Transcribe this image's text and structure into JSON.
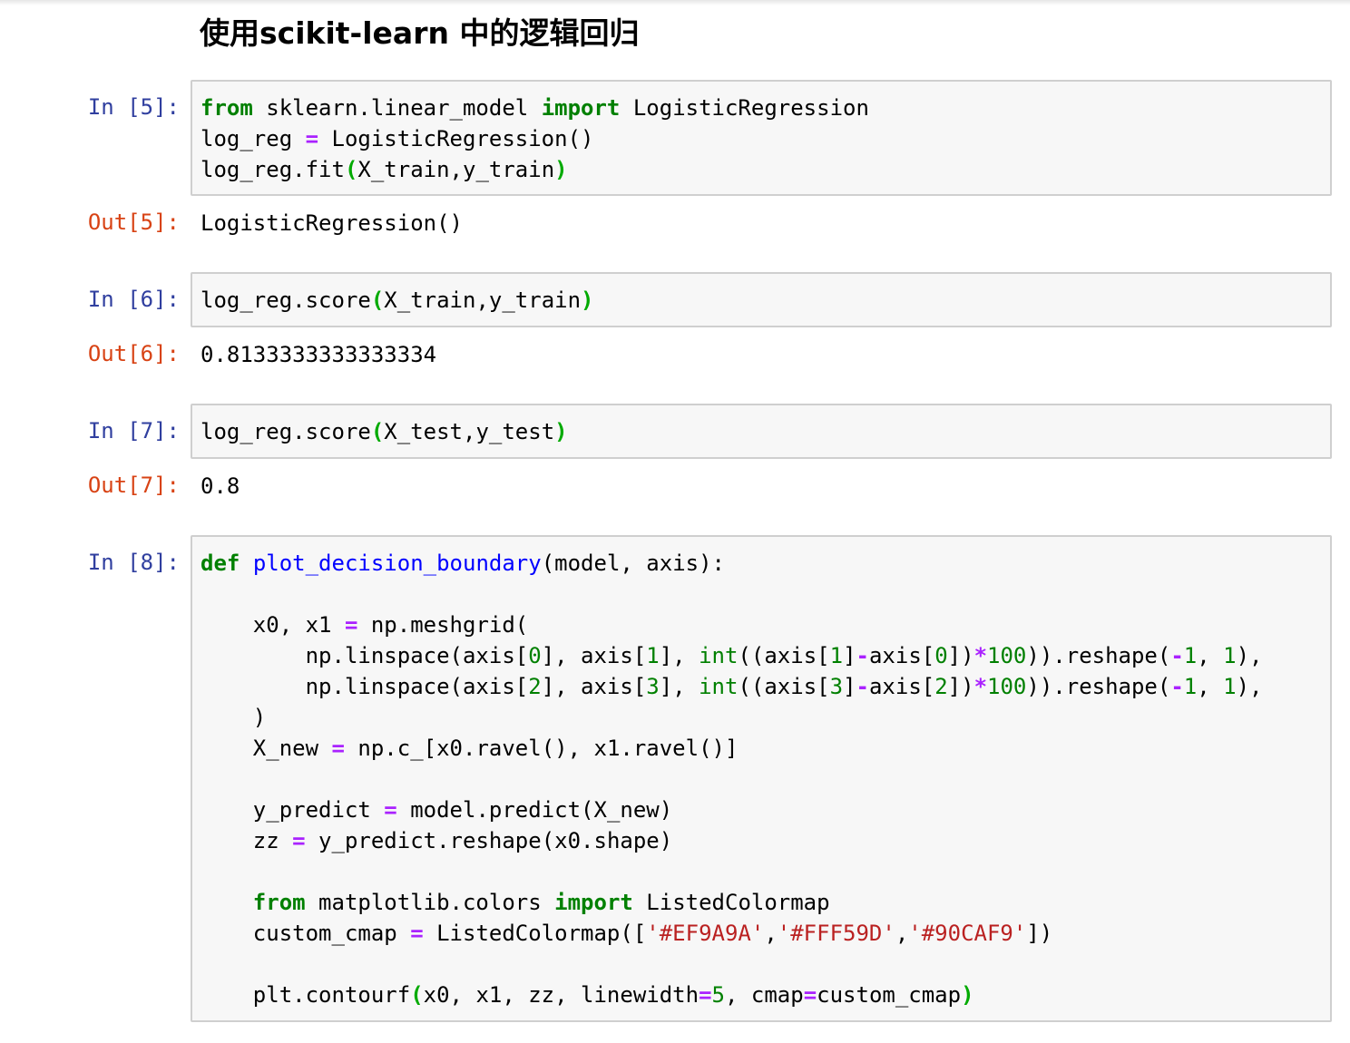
{
  "heading": "使用scikit-learn 中的逻辑回归",
  "cells": [
    {
      "in_prompt": "In [5]:",
      "code_lines": [
        [
          {
            "t": "from",
            "c": "kw"
          },
          {
            "t": " sklearn.linear_model "
          },
          {
            "t": "import",
            "c": "kw"
          },
          {
            "t": " LogisticRegression"
          }
        ],
        [
          {
            "t": "log_reg "
          },
          {
            "t": "=",
            "c": "op"
          },
          {
            "t": " LogisticRegression()"
          }
        ],
        [
          {
            "t": "log_reg.fit"
          },
          {
            "t": "(",
            "c": "paren-hl"
          },
          {
            "t": "X_train,y_train"
          },
          {
            "t": ")",
            "c": "paren-hl"
          }
        ]
      ],
      "out_prompt": "Out[5]:",
      "output": "LogisticRegression()"
    },
    {
      "in_prompt": "In [6]:",
      "code_lines": [
        [
          {
            "t": "log_reg.score"
          },
          {
            "t": "(",
            "c": "paren-hl"
          },
          {
            "t": "X_train,y_train"
          },
          {
            "t": ")",
            "c": "paren-hl"
          }
        ]
      ],
      "out_prompt": "Out[6]:",
      "output": "0.8133333333333334"
    },
    {
      "in_prompt": "In [7]:",
      "code_lines": [
        [
          {
            "t": "log_reg.score"
          },
          {
            "t": "(",
            "c": "paren-hl"
          },
          {
            "t": "X_test,y_test"
          },
          {
            "t": ")",
            "c": "paren-hl"
          }
        ]
      ],
      "out_prompt": "Out[7]:",
      "output": "0.8"
    },
    {
      "in_prompt": "In [8]:",
      "code_lines": [
        [
          {
            "t": "def",
            "c": "kw"
          },
          {
            "t": " "
          },
          {
            "t": "plot_decision_boundary",
            "c": "fn"
          },
          {
            "t": "(model, axis):"
          }
        ],
        [
          {
            "t": ""
          }
        ],
        [
          {
            "t": "    x0, x1 "
          },
          {
            "t": "=",
            "c": "op"
          },
          {
            "t": " np.meshgrid("
          }
        ],
        [
          {
            "t": "        np.linspace(axis["
          },
          {
            "t": "0",
            "c": "num"
          },
          {
            "t": "], axis["
          },
          {
            "t": "1",
            "c": "num"
          },
          {
            "t": "], "
          },
          {
            "t": "int",
            "c": "bi"
          },
          {
            "t": "((axis["
          },
          {
            "t": "1",
            "c": "num"
          },
          {
            "t": "]"
          },
          {
            "t": "-",
            "c": "op"
          },
          {
            "t": "axis["
          },
          {
            "t": "0",
            "c": "num"
          },
          {
            "t": "])"
          },
          {
            "t": "*",
            "c": "op"
          },
          {
            "t": "100",
            "c": "num"
          },
          {
            "t": ")).reshape("
          },
          {
            "t": "-",
            "c": "op"
          },
          {
            "t": "1",
            "c": "num"
          },
          {
            "t": ", "
          },
          {
            "t": "1",
            "c": "num"
          },
          {
            "t": "),"
          }
        ],
        [
          {
            "t": "        np.linspace(axis["
          },
          {
            "t": "2",
            "c": "num"
          },
          {
            "t": "], axis["
          },
          {
            "t": "3",
            "c": "num"
          },
          {
            "t": "], "
          },
          {
            "t": "int",
            "c": "bi"
          },
          {
            "t": "((axis["
          },
          {
            "t": "3",
            "c": "num"
          },
          {
            "t": "]"
          },
          {
            "t": "-",
            "c": "op"
          },
          {
            "t": "axis["
          },
          {
            "t": "2",
            "c": "num"
          },
          {
            "t": "])"
          },
          {
            "t": "*",
            "c": "op"
          },
          {
            "t": "100",
            "c": "num"
          },
          {
            "t": ")).reshape("
          },
          {
            "t": "-",
            "c": "op"
          },
          {
            "t": "1",
            "c": "num"
          },
          {
            "t": ", "
          },
          {
            "t": "1",
            "c": "num"
          },
          {
            "t": "),"
          }
        ],
        [
          {
            "t": "    )"
          }
        ],
        [
          {
            "t": "    X_new "
          },
          {
            "t": "=",
            "c": "op"
          },
          {
            "t": " np.c_[x0.ravel(), x1.ravel()]"
          }
        ],
        [
          {
            "t": ""
          }
        ],
        [
          {
            "t": "    y_predict "
          },
          {
            "t": "=",
            "c": "op"
          },
          {
            "t": " model.predict(X_new)"
          }
        ],
        [
          {
            "t": "    zz "
          },
          {
            "t": "=",
            "c": "op"
          },
          {
            "t": " y_predict.reshape(x0.shape)"
          }
        ],
        [
          {
            "t": ""
          }
        ],
        [
          {
            "t": "    "
          },
          {
            "t": "from",
            "c": "kw"
          },
          {
            "t": " matplotlib.colors "
          },
          {
            "t": "import",
            "c": "kw"
          },
          {
            "t": " ListedColormap"
          }
        ],
        [
          {
            "t": "    custom_cmap "
          },
          {
            "t": "=",
            "c": "op"
          },
          {
            "t": " ListedColormap(["
          },
          {
            "t": "'#EF9A9A'",
            "c": "str"
          },
          {
            "t": ","
          },
          {
            "t": "'#FFF59D'",
            "c": "str"
          },
          {
            "t": ","
          },
          {
            "t": "'#90CAF9'",
            "c": "str"
          },
          {
            "t": "])"
          }
        ],
        [
          {
            "t": ""
          }
        ],
        [
          {
            "t": "    plt.contourf"
          },
          {
            "t": "(",
            "c": "paren-hl"
          },
          {
            "t": "x0, x1, zz, linewidth"
          },
          {
            "t": "=",
            "c": "op"
          },
          {
            "t": "5",
            "c": "num"
          },
          {
            "t": ", cmap"
          },
          {
            "t": "=",
            "c": "op"
          },
          {
            "t": "custom_cmap"
          },
          {
            "t": ")",
            "c": "paren-hl"
          }
        ]
      ],
      "out_prompt": null,
      "output": null
    }
  ]
}
